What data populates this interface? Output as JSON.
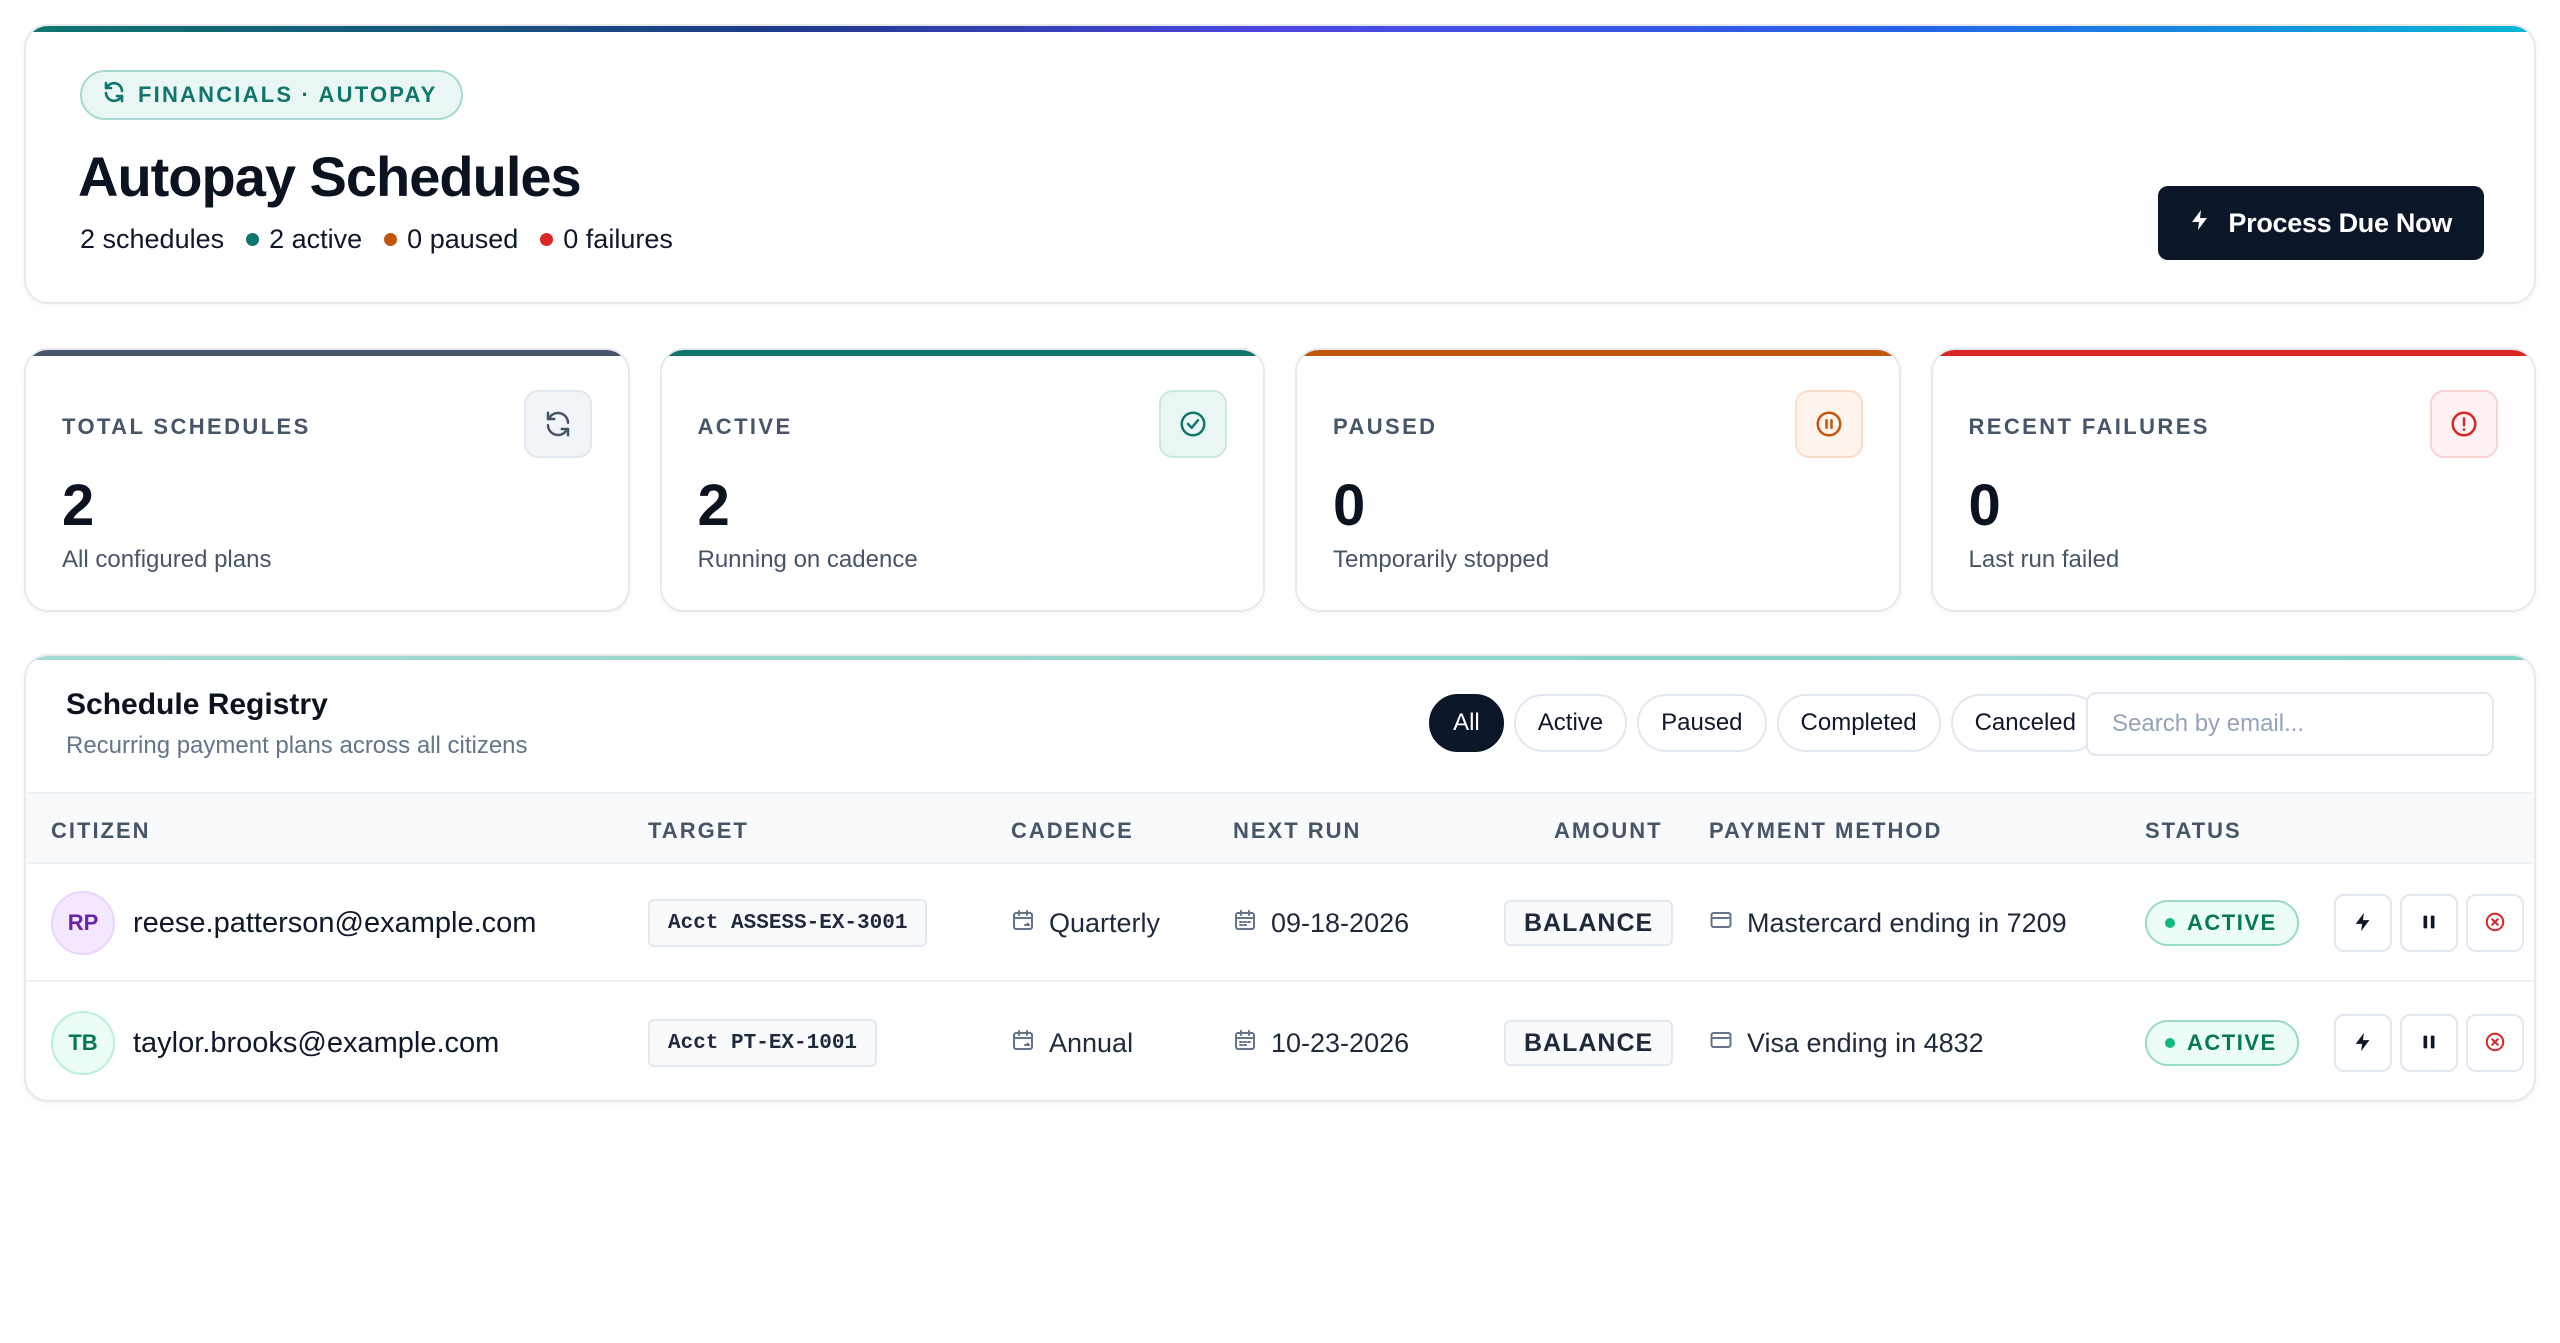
{
  "header": {
    "breadcrumb": "FINANCIALS · AUTOPAY",
    "title": "Autopay Schedules",
    "summary": {
      "schedules": "2 schedules",
      "active": "2 active",
      "paused": "0 paused",
      "failures": "0 failures"
    },
    "process_button": "Process Due Now"
  },
  "colors": {
    "teal": "#0f766e",
    "orange": "#c2570c",
    "red": "#dc2626",
    "slate": "#475569",
    "navy": "#0b1628"
  },
  "stats": [
    {
      "label": "TOTAL SCHEDULES",
      "value": "2",
      "sub": "All configured plans",
      "icon": "refresh-icon"
    },
    {
      "label": "ACTIVE",
      "value": "2",
      "sub": "Running on cadence",
      "icon": "check-circle-icon"
    },
    {
      "label": "PAUSED",
      "value": "0",
      "sub": "Temporarily stopped",
      "icon": "pause-circle-icon"
    },
    {
      "label": "RECENT FAILURES",
      "value": "0",
      "sub": "Last run failed",
      "icon": "alert-circle-icon"
    }
  ],
  "registry": {
    "title": "Schedule Registry",
    "subtitle": "Recurring payment plans across all citizens",
    "filters": [
      "All",
      "Active",
      "Paused",
      "Completed",
      "Canceled"
    ],
    "active_filter": "All",
    "search_placeholder": "Search by email...",
    "columns": [
      "CITIZEN",
      "TARGET",
      "CADENCE",
      "NEXT RUN",
      "AMOUNT",
      "PAYMENT METHOD",
      "STATUS"
    ],
    "rows": [
      {
        "initials": "RP",
        "email": "reese.patterson@example.com",
        "target": "Acct ASSESS-EX-3001",
        "cadence": "Quarterly",
        "next_run": "09-18-2026",
        "amount": "BALANCE",
        "payment_method": "Mastercard ending in 7209",
        "status": "ACTIVE"
      },
      {
        "initials": "TB",
        "email": "taylor.brooks@example.com",
        "target": "Acct PT-EX-1001",
        "cadence": "Annual",
        "next_run": "10-23-2026",
        "amount": "BALANCE",
        "payment_method": "Visa ending in 4832",
        "status": "ACTIVE"
      }
    ]
  }
}
